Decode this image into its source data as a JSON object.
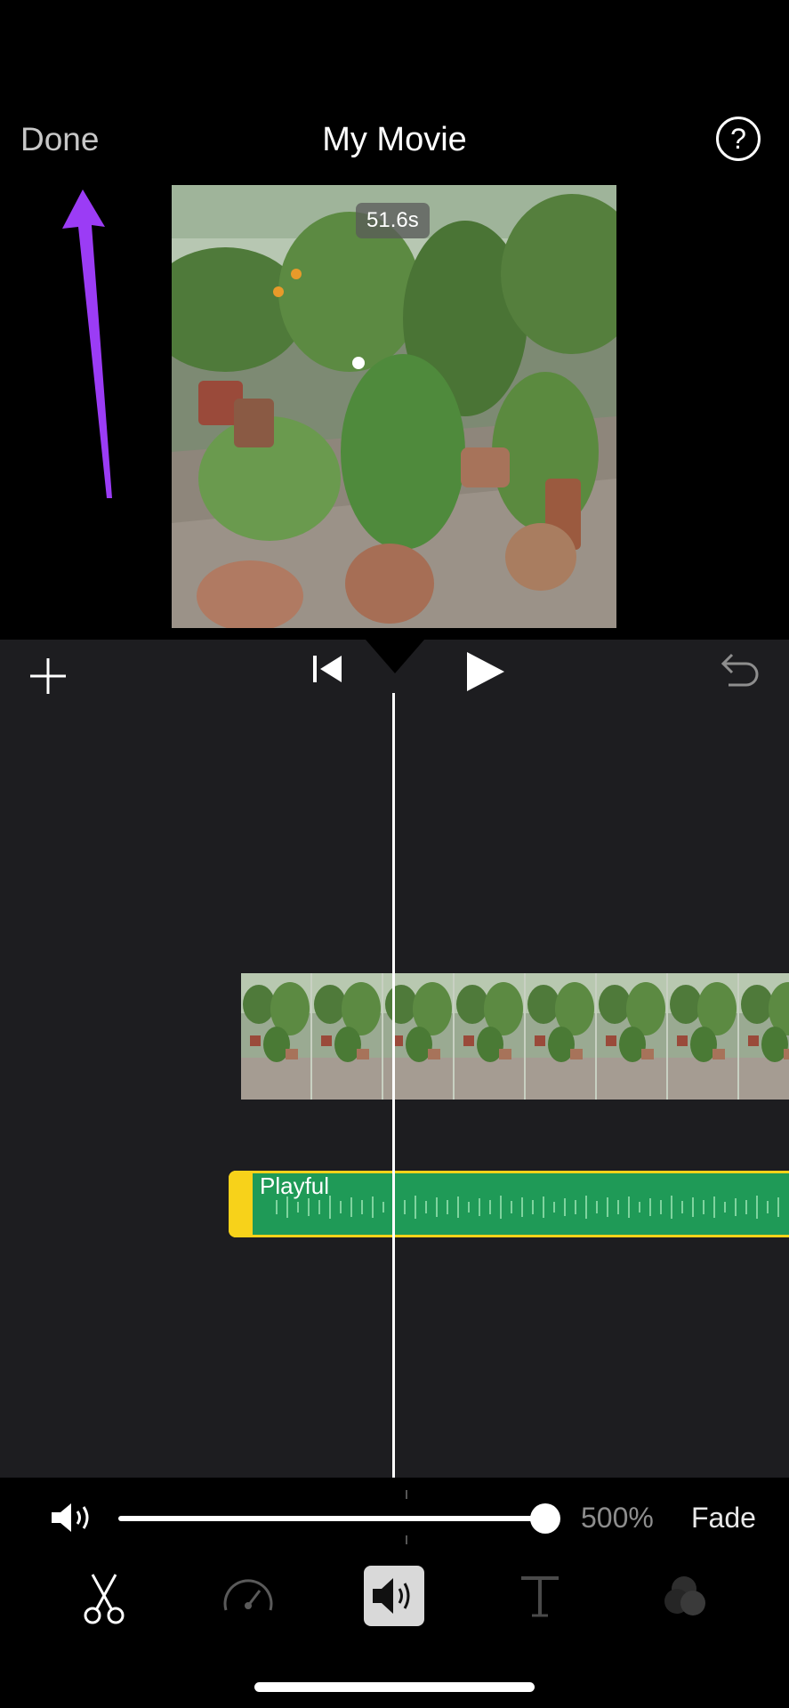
{
  "header": {
    "done_label": "Done",
    "title": "My Movie",
    "help_label": "?"
  },
  "preview": {
    "duration": "51.6s"
  },
  "timeline": {
    "audio_clip_label": "Playful"
  },
  "audio_controls": {
    "volume_percent": "500%",
    "volume_level": 1.0,
    "fade_label": "Fade"
  },
  "toolbar": {
    "tools": [
      "scissors-icon",
      "speed-icon",
      "volume-icon",
      "title-icon",
      "filters-icon"
    ],
    "active_tool": "volume-icon"
  },
  "colors": {
    "annotation_arrow": "#9b3cf5",
    "audio_clip": "#1f9a57",
    "audio_border": "#f7d21a"
  }
}
